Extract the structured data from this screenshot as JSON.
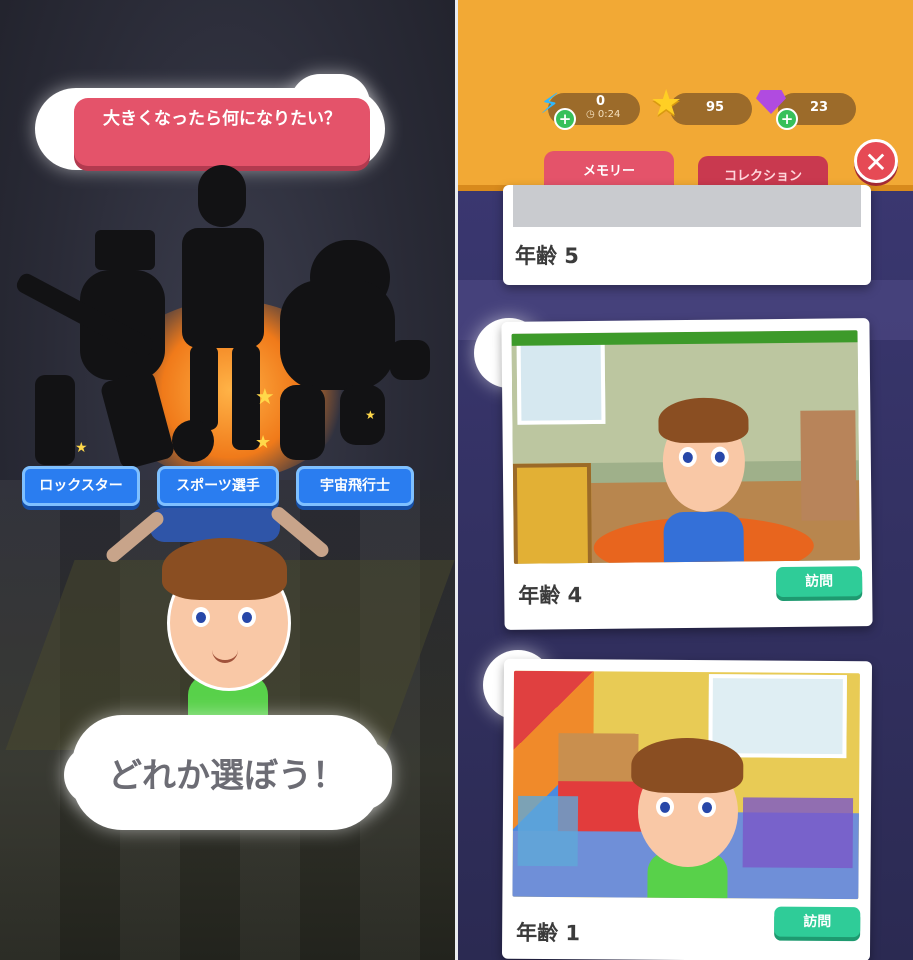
{
  "left_panel": {
    "question": "大きくなったら何になりたい？",
    "choices": [
      {
        "label": "ロックスター"
      },
      {
        "label": "スポーツ選手"
      },
      {
        "label": "宇宙飛行士"
      }
    ],
    "prompt": "どれか選ぼう！"
  },
  "right_panel": {
    "resources": {
      "energy": {
        "value": "0",
        "timer": "0:24",
        "icon": "lightning-icon"
      },
      "stars": {
        "value": "95",
        "icon": "star-icon"
      },
      "gems": {
        "value": "23",
        "icon": "gem-icon"
      }
    },
    "tabs": [
      {
        "label": "メモリー"
      },
      {
        "label": "コレクション"
      }
    ],
    "close_icon": "close-icon",
    "cards": [
      {
        "age_label": "年齢 5"
      },
      {
        "age_label": "年齢 4",
        "visit_label": "訪問"
      },
      {
        "age_label": "年齢 1",
        "visit_label": "訪問"
      }
    ]
  },
  "colors": {
    "ribbon": "#e4536a",
    "role_button": "#2a7df0",
    "topbar": "#f2a935",
    "visit_button": "#2fcc98",
    "close_button": "#e64a55"
  }
}
